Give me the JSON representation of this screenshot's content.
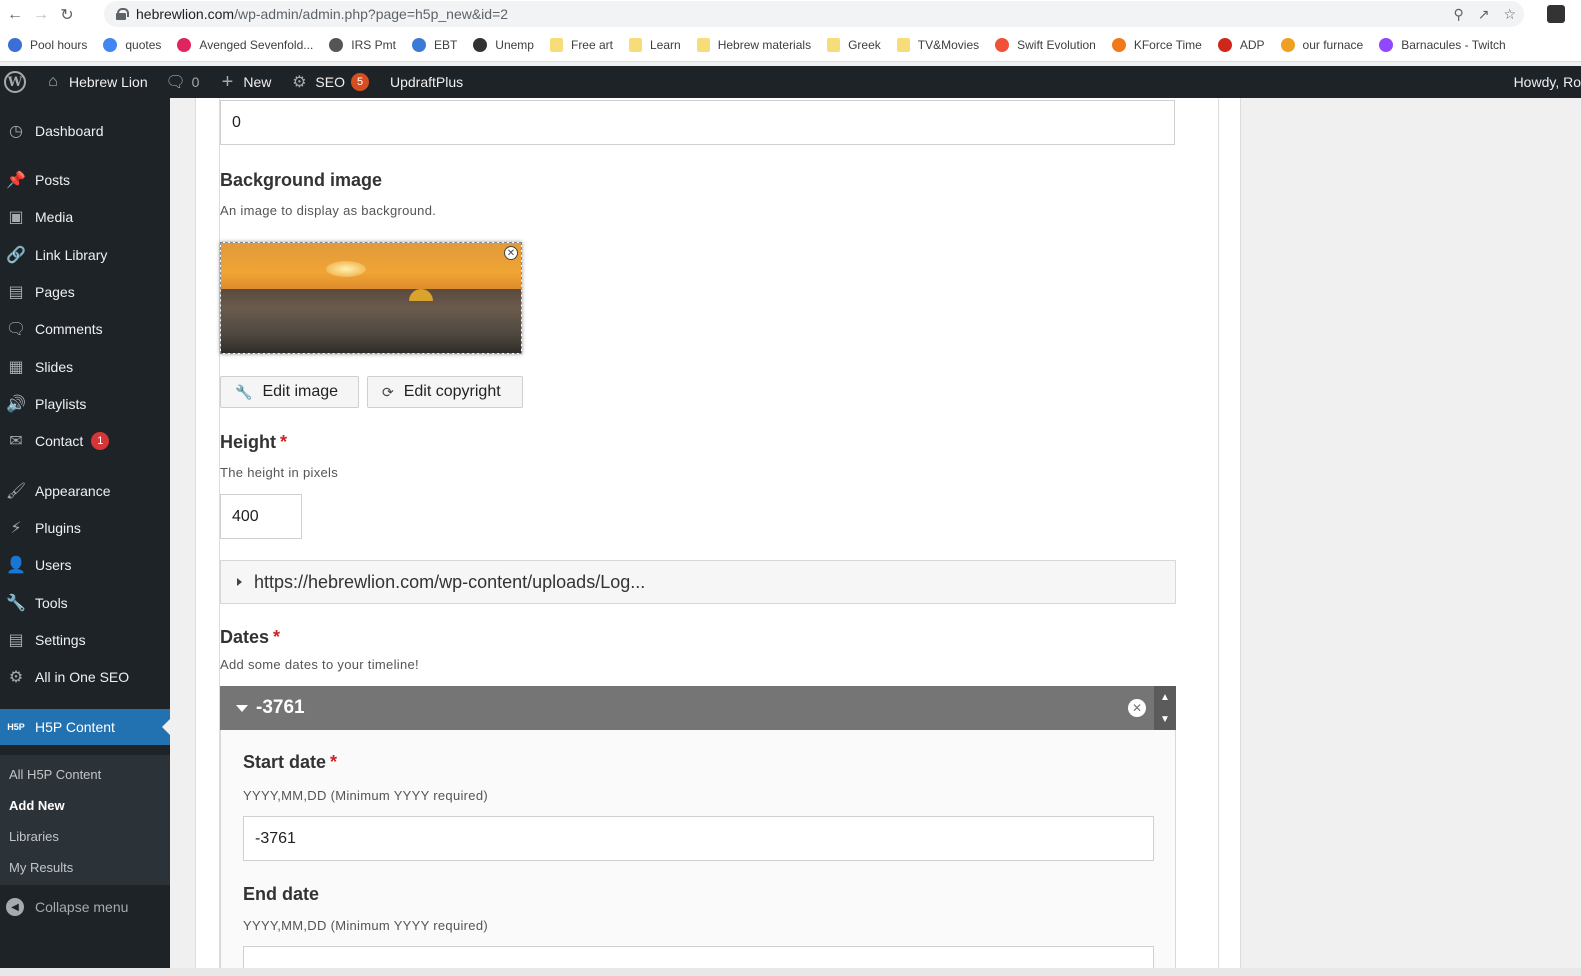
{
  "browser": {
    "url_host": "hebrewlion.com",
    "url_path": "/wp-admin/admin.php?page=h5p_new&id=2",
    "bookmarks": [
      {
        "label": "Pool hours",
        "icon": "pinwheel-icon",
        "color": "#3b6fd6"
      },
      {
        "label": "quotes",
        "icon": "google-icon",
        "color": "#4285f4"
      },
      {
        "label": "Avenged Sevenfold...",
        "icon": "band-icon",
        "color": "#e0245e"
      },
      {
        "label": "IRS Pmt",
        "icon": "irs-icon",
        "color": "#555555"
      },
      {
        "label": "EBT",
        "icon": "ebt-icon",
        "color": "#3b7bd6"
      },
      {
        "label": "Unemp",
        "icon": "unemp-icon",
        "color": "#333333"
      },
      {
        "label": "Free art",
        "icon": "folder-icon",
        "color": "#f7dd7a"
      },
      {
        "label": "Learn",
        "icon": "folder-icon",
        "color": "#f7dd7a"
      },
      {
        "label": "Hebrew materials",
        "icon": "folder-icon",
        "color": "#f7dd7a"
      },
      {
        "label": "Greek",
        "icon": "folder-icon",
        "color": "#f7dd7a"
      },
      {
        "label": "TV&Movies",
        "icon": "folder-icon",
        "color": "#f7dd7a"
      },
      {
        "label": "Swift Evolution",
        "icon": "swift-icon",
        "color": "#f05138"
      },
      {
        "label": "KForce Time",
        "icon": "kforce-icon",
        "color": "#f07a1a"
      },
      {
        "label": "ADP",
        "icon": "adp-icon",
        "color": "#d0271d"
      },
      {
        "label": "our furnace",
        "icon": "furnace-icon",
        "color": "#f0a020"
      },
      {
        "label": "Barnacules - Twitch",
        "icon": "twitch-icon",
        "color": "#9146ff"
      }
    ]
  },
  "adminbar": {
    "site_name": "Hebrew Lion",
    "comments_count": "0",
    "new_label": "New",
    "seo_label": "SEO",
    "seo_count": "5",
    "updraft_label": "UpdraftPlus",
    "howdy": "Howdy, Ro"
  },
  "sidebar": {
    "items": [
      {
        "label": "Dashboard",
        "icon": "dashboard-icon"
      },
      {
        "label": "Posts",
        "icon": "pin-icon"
      },
      {
        "label": "Media",
        "icon": "media-icon"
      },
      {
        "label": "Link Library",
        "icon": "link-icon"
      },
      {
        "label": "Pages",
        "icon": "pages-icon"
      },
      {
        "label": "Comments",
        "icon": "comment-icon"
      },
      {
        "label": "Slides",
        "icon": "slides-icon"
      },
      {
        "label": "Playlists",
        "icon": "speaker-icon"
      },
      {
        "label": "Contact",
        "icon": "mail-icon",
        "badge": "1"
      },
      {
        "label": "Appearance",
        "icon": "brush-icon"
      },
      {
        "label": "Plugins",
        "icon": "plugin-icon"
      },
      {
        "label": "Users",
        "icon": "user-icon"
      },
      {
        "label": "Tools",
        "icon": "wrench-icon"
      },
      {
        "label": "Settings",
        "icon": "settings-icon"
      },
      {
        "label": "All in One SEO",
        "icon": "seo-icon"
      },
      {
        "label": "H5P Content",
        "icon": "h5p-icon"
      }
    ],
    "submenu": [
      "All H5P Content",
      "Add New",
      "Libraries",
      "My Results"
    ],
    "collapse_label": "Collapse menu",
    "accent": "#2271b1"
  },
  "form": {
    "top_value": "0",
    "bg_image": {
      "label": "Background image",
      "description": "An image to display as background.",
      "edit_image": "Edit image",
      "edit_copyright": "Edit copyright"
    },
    "height": {
      "label": "Height",
      "required_mark": "*",
      "description": "The height in pixels",
      "value": "400"
    },
    "collapsible_url": "https://hebrewlion.com/wp-content/uploads/Log...",
    "dates": {
      "label": "Dates",
      "required_mark": "*",
      "description": "Add some dates to your timeline!",
      "entry_title": "-3761",
      "start_label": "Start date",
      "start_required": "*",
      "start_desc": "YYYY,MM,DD (Minimum YYYY required)",
      "start_value": "-3761",
      "end_label": "End date",
      "end_desc": "YYYY,MM,DD (Minimum YYYY required)",
      "end_value": ""
    }
  }
}
